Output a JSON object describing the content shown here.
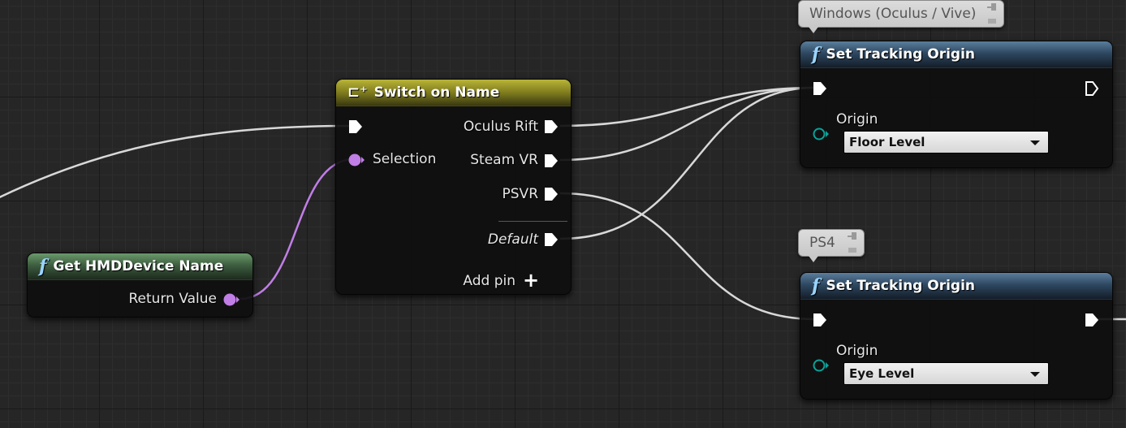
{
  "nodes": {
    "get_hmd": {
      "title": "Get HMDDevice Name",
      "return_label": "Return Value"
    },
    "switch": {
      "title": "Switch on Name",
      "selection_label": "Selection",
      "outputs": [
        "Oculus Rift",
        "Steam VR",
        "PSVR"
      ],
      "default_label": "Default",
      "add_pin_label": "Add pin"
    },
    "set_origin_pc": {
      "comment": "Windows (Oculus / Vive)",
      "title": "Set Tracking Origin",
      "origin_label": "Origin",
      "origin_value": "Floor Level"
    },
    "set_origin_ps4": {
      "comment": "PS4",
      "title": "Set Tracking Origin",
      "origin_label": "Origin",
      "origin_value": "Eye Level"
    }
  },
  "colors": {
    "exec_wire": "#d8d8d8",
    "name_wire": "#c17ee6",
    "name_pin": "#c17ee6",
    "enum_pin": "#0aa39a",
    "function_header_green": "#3e5e40",
    "function_header_blue": "#2e4862",
    "switch_header_gold": "#7f7c1e"
  },
  "icons": {
    "function": "function-f-icon",
    "switch": "switch-node-icon",
    "comment_pin": "pushpin-icon",
    "add": "plus-icon"
  }
}
